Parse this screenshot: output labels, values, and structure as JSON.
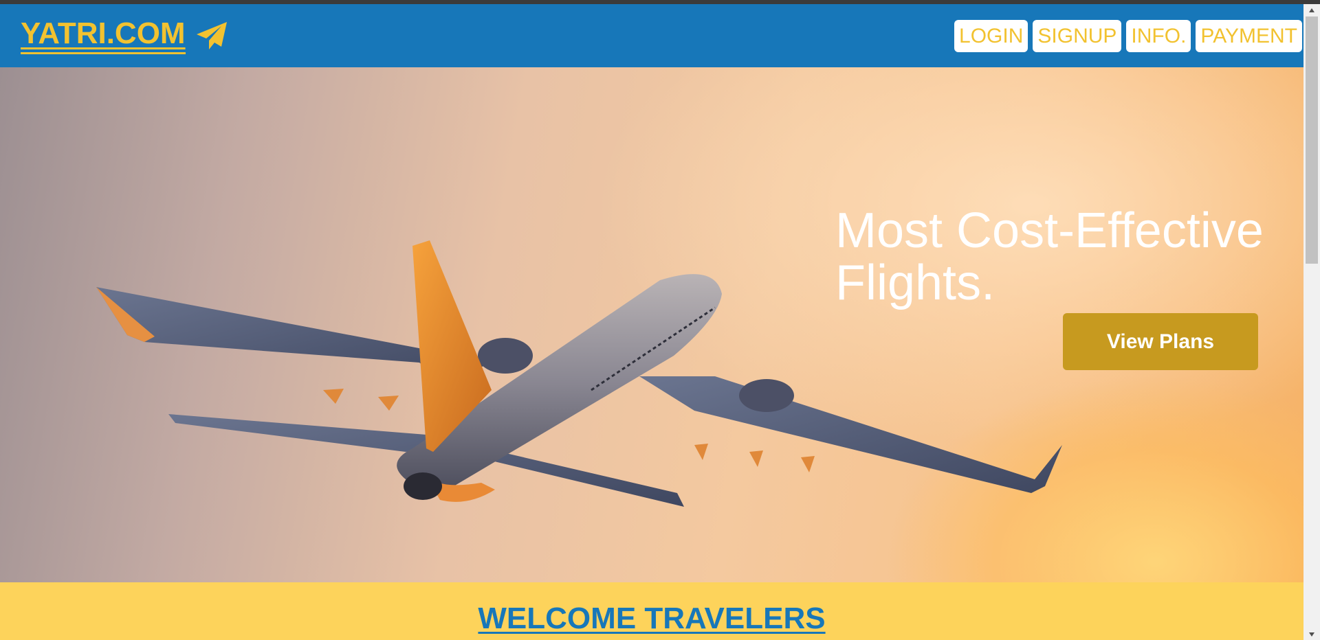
{
  "navbar": {
    "brand": "YATRI.COM",
    "brand_icon": "paper-plane-icon",
    "buttons": [
      "LOGIN",
      "SIGNUP",
      "INFO.",
      "PAYMENT"
    ]
  },
  "hero": {
    "title": "Most Cost-Effective Flights.",
    "button_label": "View Plans"
  },
  "welcome": {
    "title": "WELCOME TRAVELERS"
  },
  "colors": {
    "navbar": "#1777b9",
    "brand": "#f2c230",
    "hero_button": "#c79a1f",
    "welcome_bg": "#fdd35b"
  }
}
